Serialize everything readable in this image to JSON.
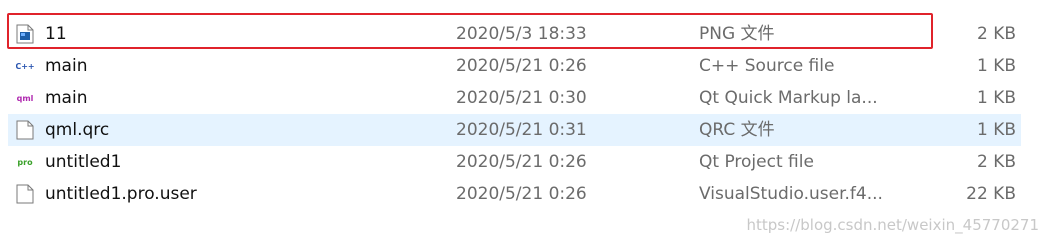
{
  "files": [
    {
      "name": "11",
      "date": "2020/5/3 18:33",
      "type": "PNG 文件",
      "size": "2 KB",
      "icon": "png-image-icon"
    },
    {
      "name": "main",
      "date": "2020/5/21 0:26",
      "type": "C++ Source file",
      "size": "1 KB",
      "icon": "cpp-source-icon"
    },
    {
      "name": "main",
      "date": "2020/5/21 0:30",
      "type": "Qt Quick Markup la...",
      "size": "1 KB",
      "icon": "qml-file-icon"
    },
    {
      "name": "qml.qrc",
      "date": "2020/5/21 0:31",
      "type": "QRC 文件",
      "size": "1 KB",
      "icon": "generic-file-icon"
    },
    {
      "name": "untitled1",
      "date": "2020/5/21 0:26",
      "type": "Qt Project file",
      "size": "2 KB",
      "icon": "pro-file-icon"
    },
    {
      "name": "untitled1.pro.user",
      "date": "2020/5/21 0:26",
      "type": "VisualStudio.user.f4...",
      "size": "22 KB",
      "icon": "generic-file-icon"
    }
  ],
  "icon_labels": {
    "cpp": "C++",
    "qml": "qml",
    "pro": "pro"
  },
  "watermark": "https://blog.csdn.net/weixin_45770271",
  "colors": {
    "highlight_border": "#e0232b",
    "selected_row_bg": "#e5f3ff"
  }
}
